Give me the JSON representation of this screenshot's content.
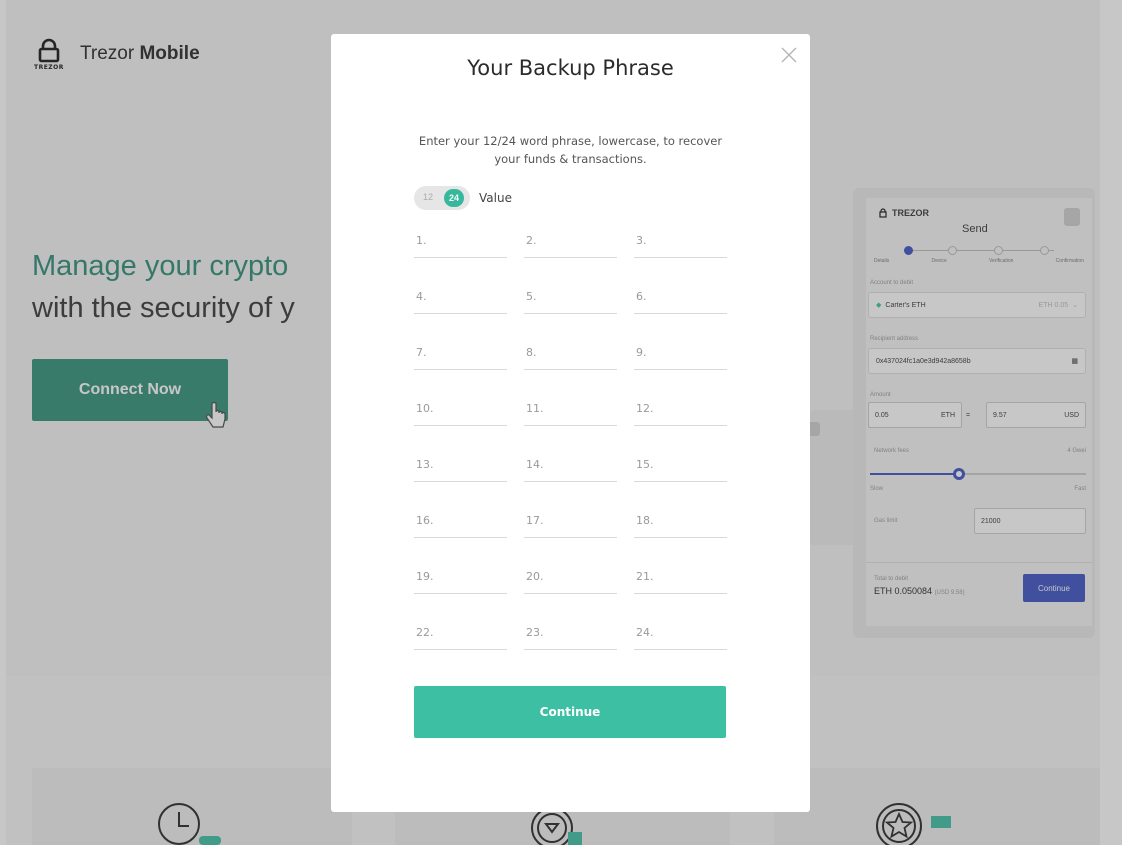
{
  "background": {
    "brand": {
      "logo_text": "TREZOR",
      "name_regular": "Trezor",
      "name_bold": "Mobile"
    },
    "hero": {
      "line1": "Manage your crypto",
      "line2": "with the security of y"
    },
    "connect_button": "Connect Now",
    "phone": {
      "logo": "TREZOR",
      "title": "Send",
      "steps": [
        "Details",
        "Device",
        "Verification",
        "Confirmation"
      ],
      "account_label": "Account to debit",
      "account_value": "Carter's ETH",
      "account_balance": "ETH 0.05",
      "recipient_label": "Recipient address",
      "recipient_value": "0x437024fc1a0e3d942a8658b",
      "amount_label": "Amount",
      "amount_value": "0.05",
      "amount_currency": "ETH",
      "equals": "=",
      "fiat_value": "9.57",
      "fiat_currency": "USD",
      "fees_label": "Network fees",
      "fees_value": "4 Gwei",
      "slider_min": "Slow",
      "slider_max": "Fast",
      "slider_level": 0.41,
      "gas_label": "Gas limit",
      "gas_value": "21000",
      "total_label": "Total to debit",
      "total_value": "ETH 0.050084",
      "total_fiat": "(USD 9.58)",
      "continue": "Continue"
    }
  },
  "modal": {
    "title": "Your Backup Phrase",
    "description": "Enter your 12/24 word phrase, lowercase, to recover your funds & transactions.",
    "toggle": {
      "option_12": "12",
      "option_24": "24",
      "selected": "24",
      "label": "Value"
    },
    "words": [
      "1.",
      "2.",
      "3.",
      "4.",
      "5.",
      "6.",
      "7.",
      "8.",
      "9.",
      "10.",
      "11.",
      "12.",
      "13.",
      "14.",
      "15.",
      "16.",
      "17.",
      "18.",
      "19.",
      "20.",
      "21.",
      "22.",
      "23.",
      "24."
    ],
    "continue": "Continue"
  },
  "colors": {
    "accent": "#3cbfa3",
    "brand_green": "#2f8f78",
    "phone_accent": "#3a4fc4"
  }
}
